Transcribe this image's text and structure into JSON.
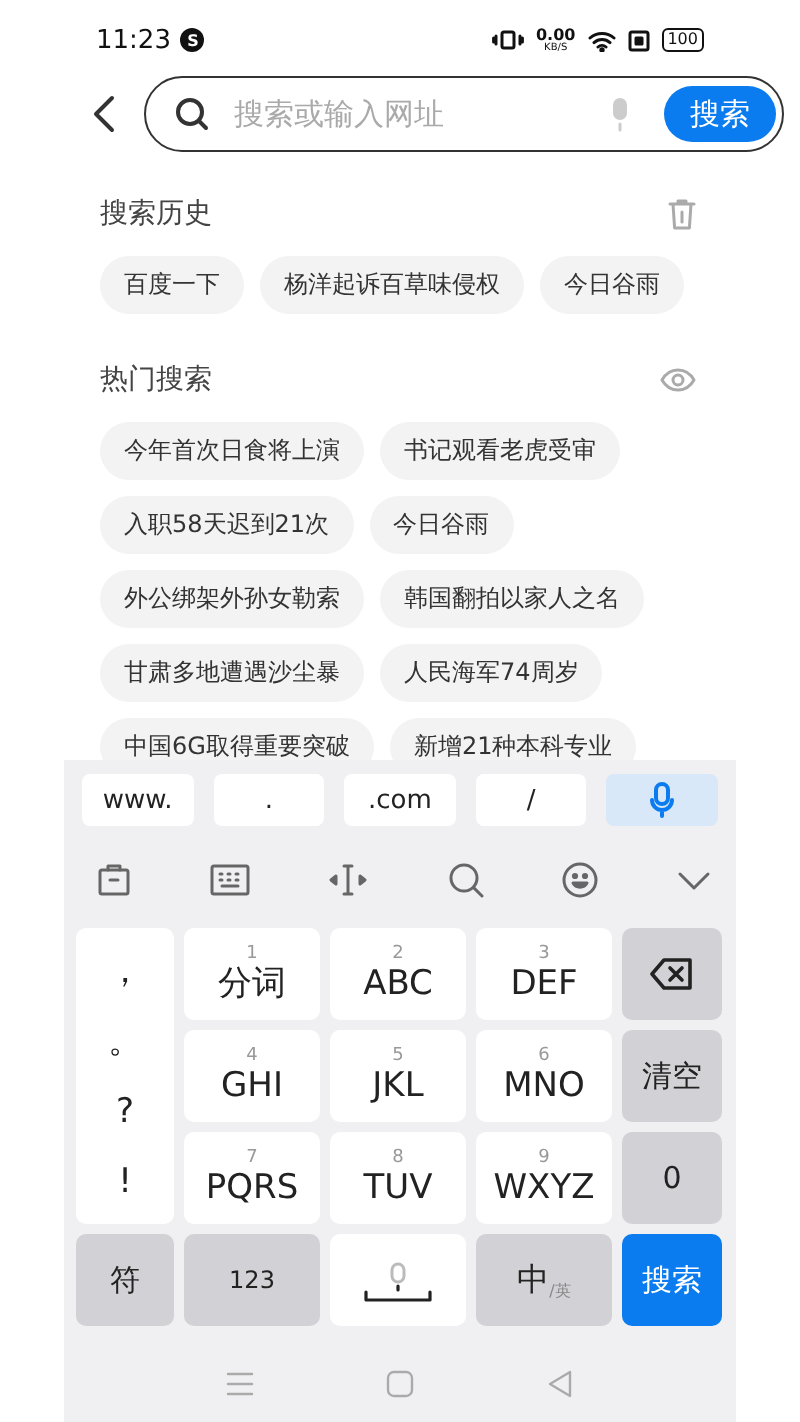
{
  "status_bar": {
    "time": "11:23",
    "badge": "S",
    "net_speed": "0.00",
    "net_unit": "KB/S",
    "battery": "100"
  },
  "search": {
    "placeholder": "搜索或输入网址",
    "button": "搜索"
  },
  "history": {
    "title": "搜索历史",
    "items": [
      "百度一下",
      "杨洋起诉百草味侵权",
      "今日谷雨"
    ]
  },
  "hot": {
    "title": "热门搜索",
    "items": [
      "今年首次日食将上演",
      "书记观看老虎受审",
      "入职58天迟到21次",
      "今日谷雨",
      "外公绑架外孙女勒索",
      "韩国翻拍以家人之名",
      "甘肃多地遭遇沙尘暴",
      "人民海军74周岁",
      "中国6G取得重要突破",
      "新增21种本科专业"
    ]
  },
  "keyboard": {
    "shortcuts": [
      "www.",
      ".",
      ".com",
      "/"
    ],
    "symbols": [
      "，",
      "。",
      "?",
      "!"
    ],
    "keys": [
      {
        "digit": "1",
        "label": "分词"
      },
      {
        "digit": "2",
        "label": "ABC"
      },
      {
        "digit": "3",
        "label": "DEF"
      },
      {
        "digit": "4",
        "label": "GHI"
      },
      {
        "digit": "5",
        "label": "JKL"
      },
      {
        "digit": "6",
        "label": "MNO"
      },
      {
        "digit": "7",
        "label": "PQRS"
      },
      {
        "digit": "8",
        "label": "TUV"
      },
      {
        "digit": "9",
        "label": "WXYZ"
      }
    ],
    "side": [
      {
        "kind": "delete"
      },
      {
        "kind": "text",
        "label": "清空"
      },
      {
        "kind": "text",
        "label": "0"
      }
    ],
    "bottom": [
      {
        "kind": "text",
        "label": "符"
      },
      {
        "kind": "text",
        "label": "123"
      },
      {
        "kind": "space"
      },
      {
        "kind": "lang",
        "label": "中",
        "sub": "/英"
      },
      {
        "kind": "action",
        "label": "搜索"
      }
    ]
  }
}
